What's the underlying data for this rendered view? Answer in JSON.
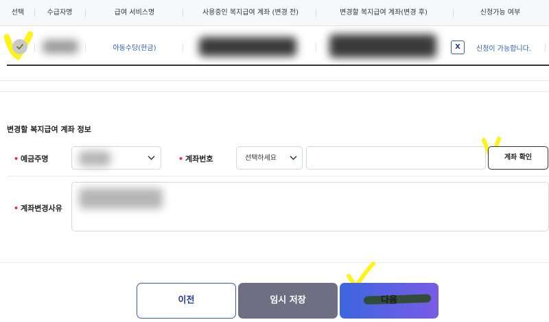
{
  "table": {
    "headers": [
      "선택",
      "수급자명",
      "급여 서비스명",
      "사용중인 복지급여 계좌 (변경 전)",
      "변경할 복지급여 계좌(변경 후)",
      "신청가능 여부"
    ],
    "row": {
      "service_name": "아동수당(현금)",
      "x_label": "X",
      "availability": "신청이 가능합니다."
    }
  },
  "form": {
    "section_title": "변경할 복지급여 계좌 정보",
    "account_holder_label": "예금주명",
    "account_number_label": "계좌번호",
    "bank_select_placeholder": "선택하세요",
    "confirm_button": "계좌 확인",
    "reason_label": "계좌변경사유"
  },
  "buttons": {
    "prev": "이전",
    "temp_save": "임시 저장",
    "next": "다음"
  },
  "colors": {
    "accent_blue": "#2d5bb9",
    "required_red": "#e0263b",
    "highlight_yellow": "#fff200",
    "temp_save_gray": "#6e6f82"
  }
}
